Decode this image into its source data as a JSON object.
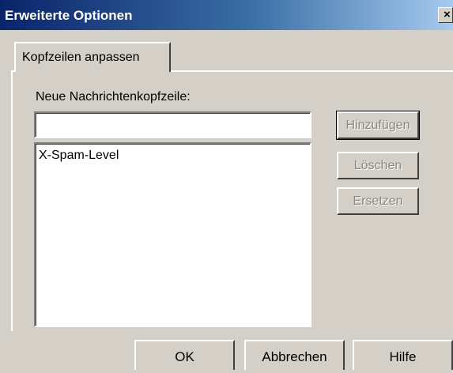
{
  "window": {
    "title": "Erweiterte Optionen",
    "close_glyph": "×"
  },
  "tabs": [
    {
      "label": "Kopfzeilen anpassen",
      "selected": true
    }
  ],
  "form": {
    "field_label": "Neue Nachrichtenkopfzeile:",
    "field_value": "",
    "list_items": [
      "X-Spam-Level"
    ]
  },
  "side_buttons": [
    {
      "label": "Hinzufügen",
      "enabled": false
    },
    {
      "label": "Löschen",
      "enabled": false
    },
    {
      "label": "Ersetzen",
      "enabled": false
    }
  ],
  "footer_buttons": [
    {
      "label": "OK"
    },
    {
      "label": "Abbrechen"
    },
    {
      "label": "Hilfe"
    }
  ],
  "colors": {
    "face": "#d4d0c8",
    "titlebar_start": "#0a246a",
    "titlebar_end": "#a6caf0",
    "disabled_text": "#8a8780"
  }
}
